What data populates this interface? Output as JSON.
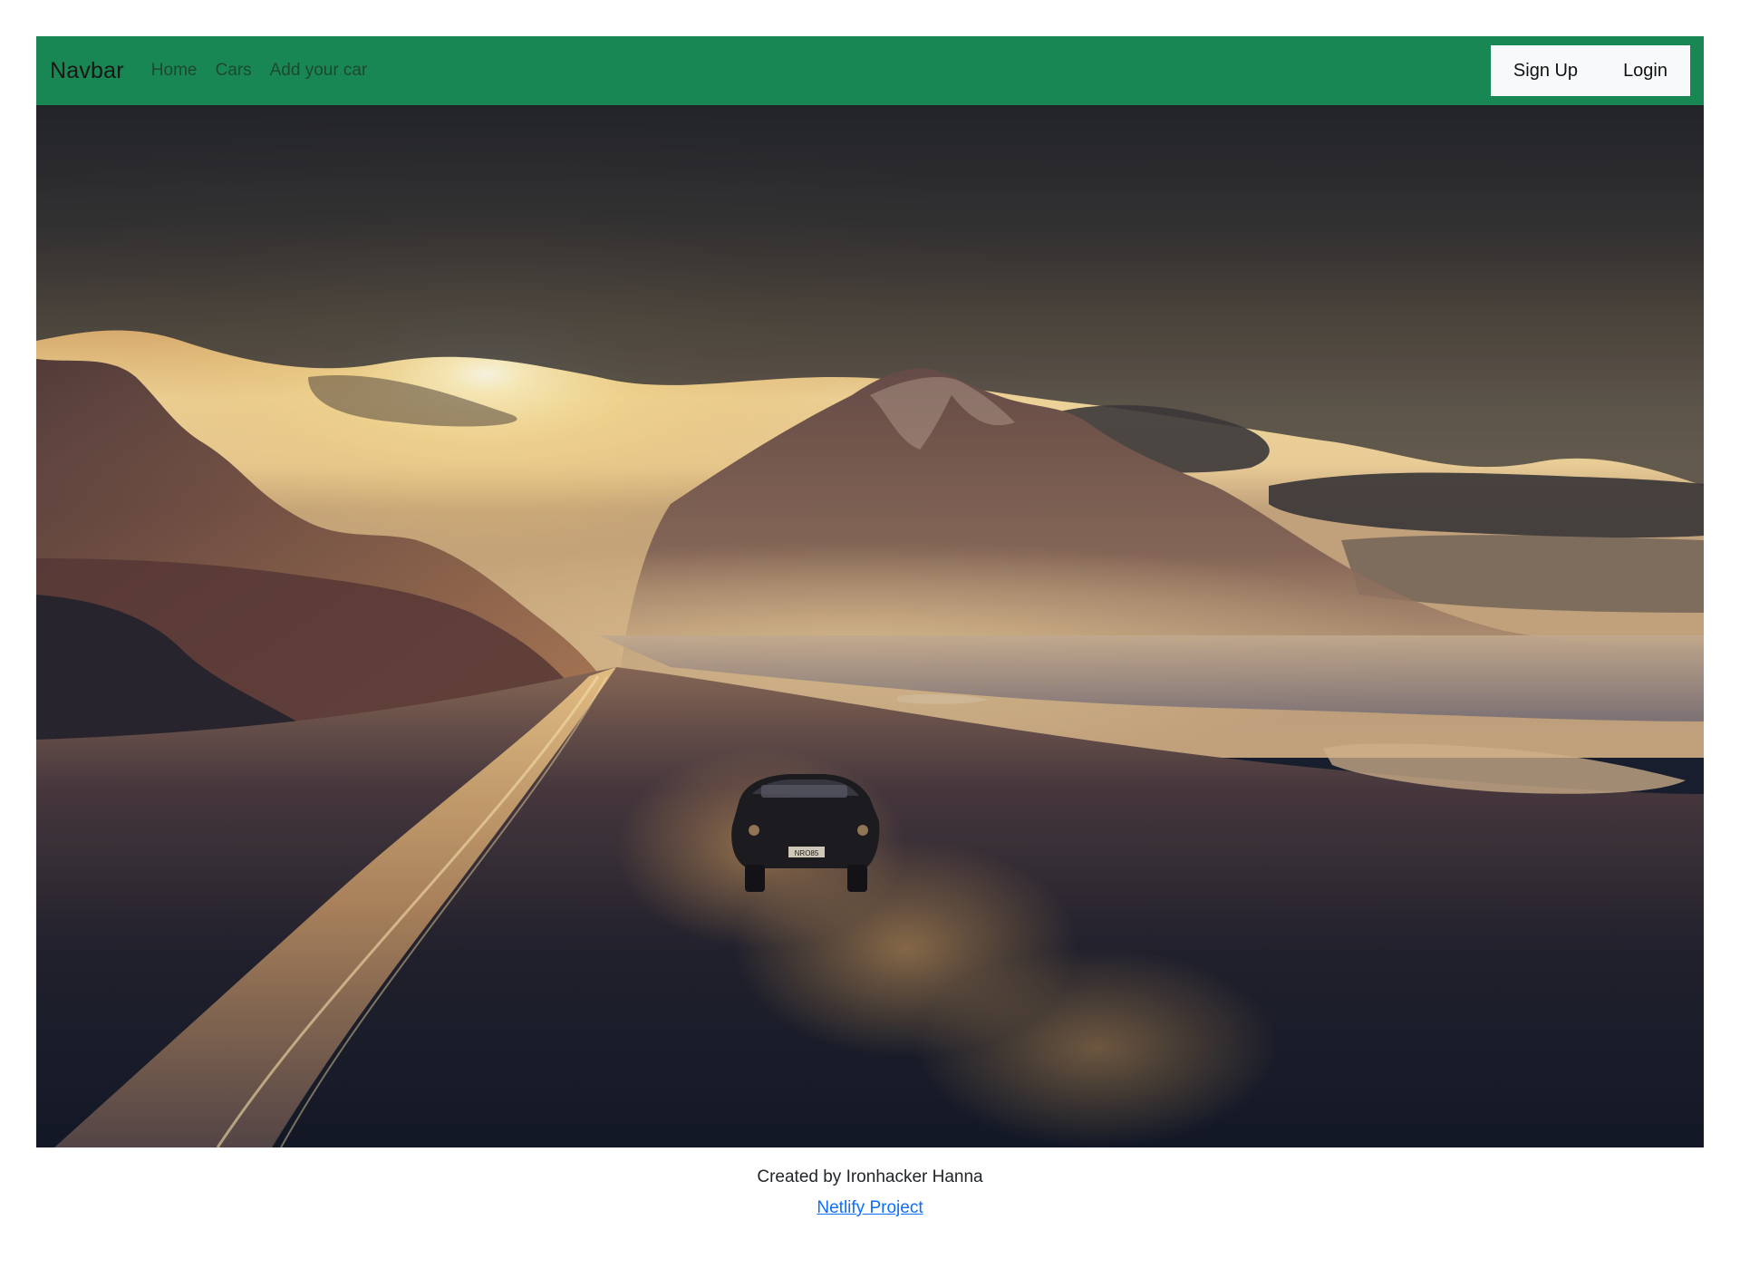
{
  "navbar": {
    "brand": "Navbar",
    "links": [
      {
        "label": "Home"
      },
      {
        "label": "Cars"
      },
      {
        "label": "Add your car"
      }
    ],
    "signup_label": "Sign Up",
    "login_label": "Login",
    "background_color": "#198754"
  },
  "hero": {
    "car_plate": "NRO85"
  },
  "footer": {
    "credit": "Created by Ironhacker Hanna",
    "link_label": "Netlify Project",
    "link_color": "#0d6efd"
  }
}
